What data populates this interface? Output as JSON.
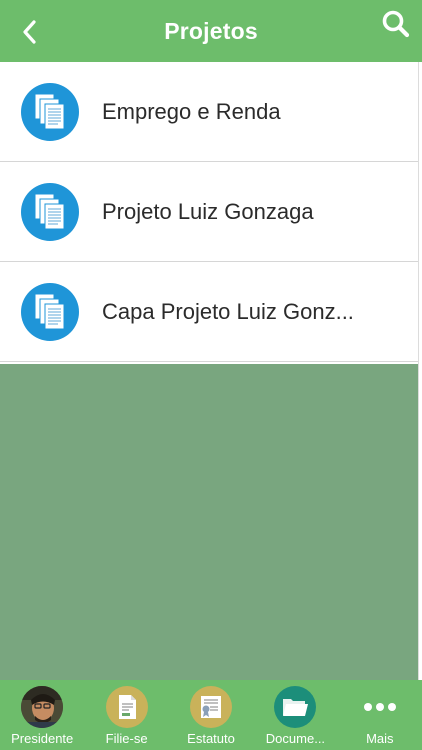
{
  "header": {
    "title": "Projetos",
    "back_icon": "chevron-left-icon",
    "search_icon": "search-icon"
  },
  "list": {
    "items": [
      {
        "label": "Emprego e Renda",
        "icon": "documents-icon"
      },
      {
        "label": "Projeto Luiz Gonzaga",
        "icon": "documents-icon"
      },
      {
        "label": "Capa Projeto Luiz Gonz...",
        "icon": "documents-icon"
      }
    ]
  },
  "tabbar": {
    "tabs": [
      {
        "label": "Presidente",
        "icon": "avatar-photo"
      },
      {
        "label": "Filie-se",
        "icon": "form-icon"
      },
      {
        "label": "Estatuto",
        "icon": "certificate-icon"
      },
      {
        "label": "Docume...",
        "icon": "folder-icon"
      },
      {
        "label": "Mais",
        "icon": "more-dots-icon"
      }
    ]
  },
  "colors": {
    "primary_green": "#6dbd6b",
    "icon_blue": "#1f95d8",
    "empty_area": "#79a67f",
    "tab_icon_gold": "#c9b25a",
    "folder_teal": "#1c8e7a"
  }
}
